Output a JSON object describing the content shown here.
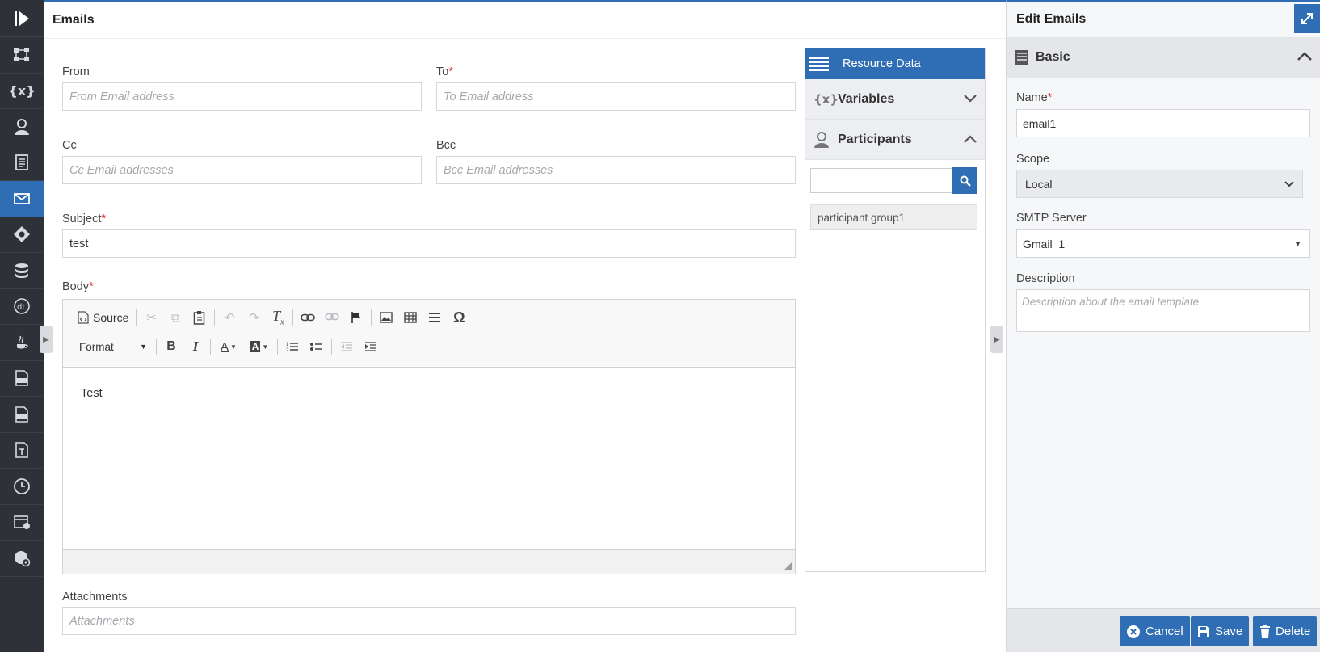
{
  "rail": {
    "items": [
      {
        "name": "process-flow-icon",
        "active": false
      },
      {
        "name": "variables-icon",
        "label": "{x}",
        "active": false
      },
      {
        "name": "participants-icon",
        "active": false
      },
      {
        "name": "document-icon",
        "active": false
      },
      {
        "name": "email-icon",
        "active": true
      },
      {
        "name": "decision-icon",
        "active": false
      },
      {
        "name": "database-icon",
        "active": false
      },
      {
        "name": "decision-table-icon",
        "active": false
      },
      {
        "name": "java-icon",
        "active": false
      },
      {
        "name": "js-file-icon",
        "active": false
      },
      {
        "name": "css-file-icon",
        "active": false
      },
      {
        "name": "text-file-icon",
        "active": false
      },
      {
        "name": "clock-icon",
        "active": false
      },
      {
        "name": "calendar-icon",
        "active": false
      },
      {
        "name": "settings-globe-icon",
        "active": false
      }
    ]
  },
  "main": {
    "title": "Emails",
    "from": {
      "label": "From",
      "placeholder": "From Email address"
    },
    "to": {
      "label": "To",
      "required": "*",
      "placeholder": "To Email address"
    },
    "cc": {
      "label": "Cc",
      "placeholder": "Cc Email addresses"
    },
    "bcc": {
      "label": "Bcc",
      "placeholder": "Bcc Email addresses"
    },
    "subject": {
      "label": "Subject",
      "required": "*",
      "value": "test"
    },
    "body": {
      "label": "Body",
      "required": "*",
      "content": "Test"
    },
    "editor": {
      "source_label": "Source",
      "format_label": "Format"
    },
    "attachments": {
      "label": "Attachments",
      "placeholder": "Attachments"
    }
  },
  "resource": {
    "header": "Resource Data",
    "variables_label": "Variables",
    "variables_icon_text": "{x}",
    "participants_label": "Participants",
    "item": "participant group1"
  },
  "right": {
    "title": "Edit Emails",
    "section": "Basic",
    "name": {
      "label": "Name",
      "required": "*",
      "value": "email1"
    },
    "scope": {
      "label": "Scope",
      "value": "Local"
    },
    "smtp": {
      "label": "SMTP Server",
      "value": "Gmail_1"
    },
    "description": {
      "label": "Description",
      "placeholder": "Description about the email template"
    },
    "buttons": {
      "cancel": "Cancel",
      "save": "Save",
      "delete": "Delete"
    }
  },
  "colors": {
    "accent": "#2f6db5",
    "rail": "#2e3138",
    "required": "#d9262c"
  }
}
